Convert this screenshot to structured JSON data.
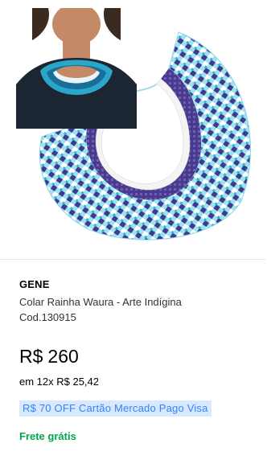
{
  "product": {
    "brand": "GENE",
    "title_line1": "Colar Rainha Waura - Arte Indígina",
    "title_line2": "Cod.130915",
    "price": {
      "currency": "R$",
      "amount": "260"
    },
    "installments": "em 12x R$ 25,42",
    "promo": "R$ 70 OFF Cartão Mercado Pago Visa",
    "shipping": "Frete grátis"
  },
  "colors": {
    "promo_text": "#3483fa",
    "promo_bg": "#d8e8ff",
    "shipping_text": "#00a650",
    "bead_light_blue": "#7fd3e6",
    "bead_purple": "#4b3a8c",
    "bead_white": "#ffffff"
  },
  "icons": {
    "product_image": "beaded-collar-necklace-image",
    "model_image": "model-wearing-necklace-image"
  }
}
